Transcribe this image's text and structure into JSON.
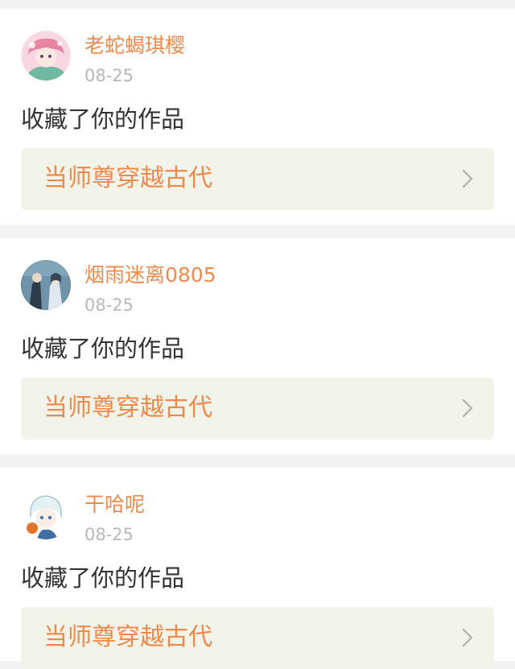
{
  "notifications": [
    {
      "username": "老蛇蝎琪樱",
      "date": "08-25",
      "action": "收藏了你的作品",
      "work_title": "当师尊穿越古代",
      "avatar_icon": "anime-avatar-pink-hair-icon"
    },
    {
      "username": "烟雨迷离0805",
      "date": "08-25",
      "action": "收藏了你的作品",
      "work_title": "当师尊穿越古代",
      "avatar_icon": "anime-avatar-two-figures-icon"
    },
    {
      "username": "干哈呢",
      "date": "08-25",
      "action": "收藏了你的作品",
      "work_title": "当师尊穿越古代",
      "avatar_icon": "anime-avatar-white-hair-icon"
    }
  ],
  "colors": {
    "accent": "#ef8a4c",
    "date": "#b8b8b8",
    "text": "#333333",
    "link_bg": "#f2f3e9",
    "page_bg": "#f3f3f3"
  }
}
